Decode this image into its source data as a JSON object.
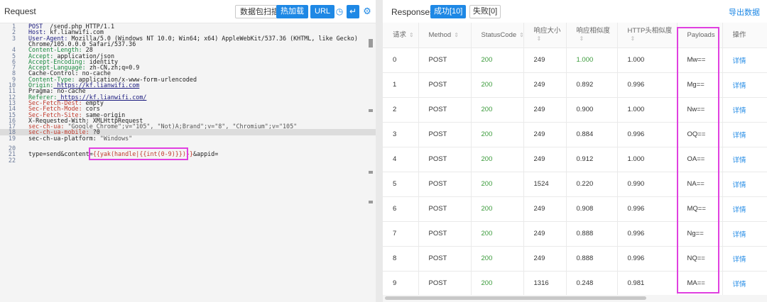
{
  "request": {
    "title": "Request",
    "toolbar": {
      "scan": "数据包扫描",
      "hot": "热加载",
      "url": "URL",
      "clock_icon": "clock-icon",
      "wrap_icon": "wrap-icon",
      "gear_icon": "gear-icon"
    },
    "lines": [
      {
        "n": "1",
        "parts": [
          [
            "kh",
            "POST"
          ],
          [
            "",
            "  /send.php HTTP/1.1"
          ]
        ]
      },
      {
        "n": "2",
        "parts": [
          [
            "kh",
            "Host:"
          ],
          [
            "",
            " kf.lianwifi.com"
          ]
        ]
      },
      {
        "n": "3",
        "parts": [
          [
            "kh",
            "User-Agent:"
          ],
          [
            "",
            " Mozilla/5.0 (Windows NT 10.0; Win64; x64) AppleWebKit/537.36 (KHTML, like Gecko)"
          ]
        ]
      },
      {
        "n": "",
        "parts": [
          [
            "",
            "Chrome/105.0.0.0 Safari/537.36"
          ]
        ]
      },
      {
        "n": "4",
        "parts": [
          [
            "k",
            "Content-Length:"
          ],
          [
            "",
            " 28"
          ]
        ]
      },
      {
        "n": "5",
        "parts": [
          [
            "k",
            "Accept:"
          ],
          [
            "",
            " application/json"
          ]
        ]
      },
      {
        "n": "6",
        "parts": [
          [
            "k",
            "Accept-Encoding:"
          ],
          [
            "",
            " identity"
          ]
        ]
      },
      {
        "n": "7",
        "parts": [
          [
            "k",
            "Accept-Language:"
          ],
          [
            "",
            " zh-CN,zh;q=0.9"
          ]
        ]
      },
      {
        "n": "8",
        "parts": [
          [
            "",
            "Cache-Control: no-cache"
          ]
        ]
      },
      {
        "n": "9",
        "parts": [
          [
            "k",
            "Content-Type:"
          ],
          [
            "",
            " application/x-www-form-urlencoded"
          ]
        ]
      },
      {
        "n": "10",
        "parts": [
          [
            "k",
            "Origin:"
          ],
          [
            "u",
            " https://kf.lianwifi.com"
          ]
        ]
      },
      {
        "n": "11",
        "parts": [
          [
            "",
            "Pragma: no-cache"
          ]
        ]
      },
      {
        "n": "12",
        "parts": [
          [
            "k",
            "Referer:"
          ],
          [
            "u",
            " https://kf.lianwifi.com/"
          ]
        ]
      },
      {
        "n": "13",
        "parts": [
          [
            "red",
            "Sec-Fetch-Dest:"
          ],
          [
            "",
            " empty"
          ]
        ]
      },
      {
        "n": "14",
        "parts": [
          [
            "red",
            "Sec-Fetch-Mode:"
          ],
          [
            "",
            " cors"
          ]
        ]
      },
      {
        "n": "15",
        "parts": [
          [
            "red",
            "Sec-Fetch-Site:"
          ],
          [
            "",
            " same-origin"
          ]
        ]
      },
      {
        "n": "16",
        "parts": [
          [
            "",
            "X-Requested-With: XMLHttpRequest"
          ]
        ]
      },
      {
        "n": "17",
        "parts": [
          [
            "red",
            "sec-ch-ua:"
          ],
          [
            "s",
            " \"Google Chrome\";v=\"105\", \"Not)A;Brand\";v=\"8\", \"Chromium\";v=\"105\""
          ]
        ]
      },
      {
        "n": "18",
        "hl": true,
        "parts": [
          [
            "red",
            "sec-ch-ua-mobile:"
          ],
          [
            "",
            " ?0"
          ]
        ]
      },
      {
        "n": "19",
        "parts": [
          [
            "",
            "sec-ch-ua-platform: "
          ],
          [
            "s",
            "\"Windows\""
          ]
        ]
      },
      {
        "n": "20",
        "parts": []
      },
      {
        "n": "21",
        "parts": [
          [
            "",
            "type=send&content="
          ],
          [
            "red",
            "{{yak(handle|{{int(0-9)}})}}"
          ],
          [
            "",
            "&appid="
          ]
        ]
      },
      {
        "n": "22",
        "parts": []
      }
    ]
  },
  "responses": {
    "title": "Responses",
    "tab_ok": "成功[10]",
    "tab_fail": "失败[0]",
    "export": "导出数据",
    "columns": [
      "请求",
      "Method",
      "StatusCode",
      "响应大小",
      "响应相似度",
      "HTTP头相似度",
      "Payloads",
      "操作"
    ],
    "rows": [
      [
        "0",
        "POST",
        "200",
        "249",
        "1.000",
        "1.000",
        "Mw==",
        "详情"
      ],
      [
        "1",
        "POST",
        "200",
        "249",
        "0.892",
        "0.996",
        "Mg==",
        "详情"
      ],
      [
        "2",
        "POST",
        "200",
        "249",
        "0.900",
        "1.000",
        "Nw==",
        "详情"
      ],
      [
        "3",
        "POST",
        "200",
        "249",
        "0.884",
        "0.996",
        "OQ==",
        "详情"
      ],
      [
        "4",
        "POST",
        "200",
        "249",
        "0.912",
        "1.000",
        "OA==",
        "详情"
      ],
      [
        "5",
        "POST",
        "200",
        "1524",
        "0.220",
        "0.990",
        "NA==",
        "详情"
      ],
      [
        "6",
        "POST",
        "200",
        "249",
        "0.908",
        "0.996",
        "MQ==",
        "详情"
      ],
      [
        "7",
        "POST",
        "200",
        "249",
        "0.888",
        "0.996",
        "Ng==",
        "详情"
      ],
      [
        "8",
        "POST",
        "200",
        "249",
        "0.888",
        "0.996",
        "NQ==",
        "详情"
      ],
      [
        "9",
        "POST",
        "200",
        "1316",
        "0.248",
        "0.981",
        "MA==",
        "详情"
      ]
    ]
  },
  "colors": {
    "accent": "#1e88e5",
    "highlight_box": "#e040e0",
    "status_ok": "#3a9a3a"
  }
}
